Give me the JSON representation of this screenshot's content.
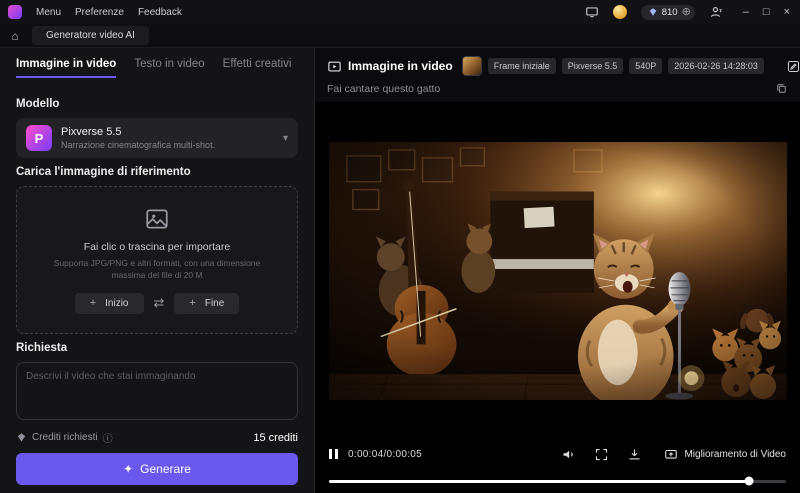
{
  "colors": {
    "accent": "#6a58ef"
  },
  "icons": {
    "home": "⌂",
    "chevron_down": "▾",
    "swap": "⇄",
    "plus": "+",
    "sparkle": "✦",
    "info": "ⓘ",
    "add_circle": "⊕",
    "minimize": "–",
    "maximize": "□",
    "close": "×"
  },
  "titlebar": {
    "menu": "Menu",
    "preferences": "Preferenze",
    "feedback": "Feedback",
    "credits": "810"
  },
  "tabbar": {
    "active_tab": "Generatore video AI"
  },
  "left_panel": {
    "tabs": [
      {
        "label": "Immagine in video"
      },
      {
        "label": "Testo in video"
      },
      {
        "label": "Effetti creativi"
      }
    ],
    "model": {
      "section": "Modello",
      "name": "Pixverse 5.5",
      "desc": "Narrazione cinematografica multi-shot.",
      "badge_letter": "P"
    },
    "upload": {
      "section": "Carica l'immagine di riferimento",
      "title": "Fai clic o trascina per importare",
      "hint": "Supporta JPG/PNG e altri formati, con una dimensione massima del file di 20 M",
      "start": "Inizio",
      "end": "Fine"
    },
    "request": {
      "section": "Richiesta",
      "placeholder": "Descrivi il video che stai immaginando"
    },
    "footer": {
      "credits_label": "Crediti richiesti",
      "credits_value": "15 crediti",
      "generate": "Generare"
    }
  },
  "right_panel": {
    "header": {
      "title": "Immagine in video",
      "badges": [
        "Frame iniziale",
        "Pixverse 5.5",
        "540P"
      ],
      "timestamp": "2026-02-26 14:28:03"
    },
    "prompt": "Fai cantare questo gatto",
    "player": {
      "time": "0:00:04/0:00:05",
      "enhance": "Miglioramento di Video",
      "progress_pct": 92
    }
  }
}
